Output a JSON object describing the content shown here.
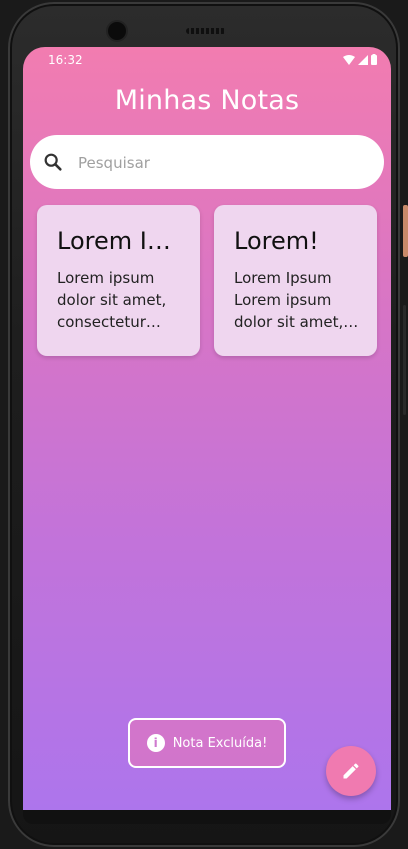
{
  "status": {
    "time": "16:32"
  },
  "header": {
    "title": "Minhas Notas"
  },
  "search": {
    "placeholder": "Pesquisar",
    "value": ""
  },
  "notes": [
    {
      "title": "Lorem Ipsum",
      "body": "Lorem ipsum dolor sit amet, consectetur adipiscing elit"
    },
    {
      "title": "Lorem!",
      "body": "Lorem Ipsum Lorem ipsum dolor sit amet, consectetur"
    }
  ],
  "toast": {
    "message": "Nota Excluída!",
    "icon": "info-icon"
  },
  "fab": {
    "icon": "pencil-icon"
  },
  "colors": {
    "gradient_top": "#f27cb0",
    "gradient_bottom": "#ad75ec",
    "card_bg": "#efd6ef",
    "fab_bg": "#f07ab0"
  }
}
